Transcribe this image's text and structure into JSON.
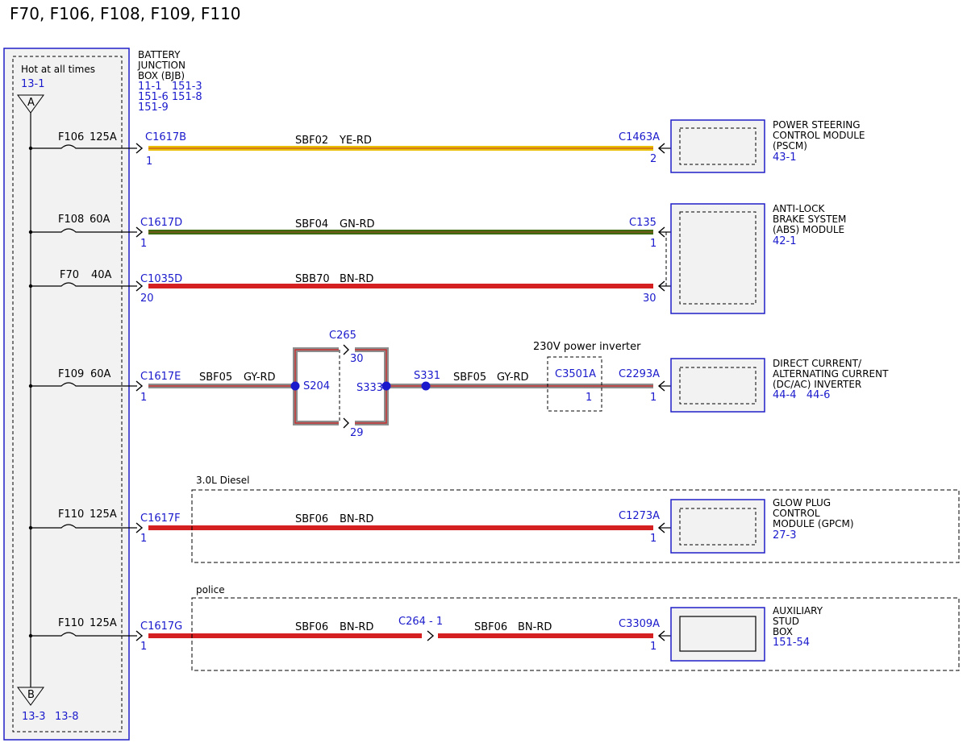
{
  "title": "F70, F106, F108, F109, F110",
  "bjb": {
    "hot_label": "Hot at all times",
    "hot_ref": "13-1",
    "name_lines": [
      "BATTERY",
      "JUNCTION",
      "BOX (BJB)"
    ],
    "refs_lines": [
      "11-1   151-3",
      "151-6 151-8",
      "151-9"
    ],
    "node_a": "A",
    "node_b": "B",
    "bottom_refs": [
      "13-3",
      "13-8"
    ]
  },
  "fuses": [
    {
      "name": "F106",
      "rating": "125A"
    },
    {
      "name": "F108",
      "rating": "60A"
    },
    {
      "name": "F70",
      "rating": "40A"
    },
    {
      "name": "F109",
      "rating": "60A"
    },
    {
      "name": "F110",
      "rating": "125A"
    },
    {
      "name": "F110",
      "rating": "125A"
    }
  ],
  "circuits": [
    {
      "from_connector": "C1617B",
      "from_pin": "1",
      "circuit": "SBF02",
      "color": "YE-RD",
      "to_connector": "C1463A",
      "to_pin": "2"
    },
    {
      "from_connector": "C1617D",
      "from_pin": "1",
      "circuit": "SBF04",
      "color": "GN-RD",
      "to_connector": "C135",
      "to_pin": "1"
    },
    {
      "from_connector": "C1035D",
      "from_pin": "20",
      "circuit": "SBB70",
      "color": "BN-RD",
      "to_connector": "",
      "to_pin": "30"
    },
    {
      "from_connector": "C1617E",
      "from_pin": "1",
      "circuit": "SBF05",
      "color": "GY-RD",
      "to_connector": "C2293A",
      "to_pin": "1"
    },
    {
      "from_connector": "C1617F",
      "from_pin": "1",
      "circuit": "SBF06",
      "color": "BN-RD",
      "to_connector": "C1273A",
      "to_pin": "1"
    },
    {
      "from_connector": "C1617G",
      "from_pin": "1",
      "circuit": "SBF06",
      "color": "BN-RD",
      "to_connector": "C3309A",
      "to_pin": "1"
    }
  ],
  "splices": {
    "s204": "S204",
    "s333": "S333",
    "s331": "S331",
    "c265": "C265",
    "c265_pin_top": "30",
    "c265_pin_bottom": "29",
    "after_splice_circuit": "SBF05",
    "after_splice_color": "GY-RD"
  },
  "inverter": {
    "label": "230V power inverter",
    "connector": "C3501A",
    "pin": "1"
  },
  "option_diesel": "3.0L Diesel",
  "option_police": "police",
  "inline_connector": "C264 - 1",
  "police_second_circuit": "SBF06",
  "police_second_color": "BN-RD",
  "modules": [
    {
      "lines": [
        "POWER STEERING",
        "CONTROL MODULE",
        "(PSCM)"
      ],
      "ref": "43-1"
    },
    {
      "lines": [
        "ANTI-LOCK",
        "BRAKE SYSTEM",
        "(ABS) MODULE"
      ],
      "ref": "42-1"
    },
    {
      "lines": [
        "DIRECT CURRENT/",
        "ALTERNATING CURRENT",
        "(DC/AC) INVERTER"
      ],
      "ref": "44-4   44-6"
    },
    {
      "lines": [
        "GLOW PLUG",
        "CONTROL",
        "MODULE (GPCM)"
      ],
      "ref": "27-3"
    },
    {
      "lines": [
        "AUXILIARY",
        "STUD",
        "BOX"
      ],
      "ref": "151-54"
    }
  ],
  "wire_colors": {
    "yellow": "#e8c000",
    "yellow_stripe": "#c0392b",
    "green": "#3d6b10",
    "red": "#d42020",
    "gray": "#8c8c8c",
    "blue": "#1a1acc",
    "module_border": "#2020c8",
    "box_fill": "#f2f2f2"
  }
}
